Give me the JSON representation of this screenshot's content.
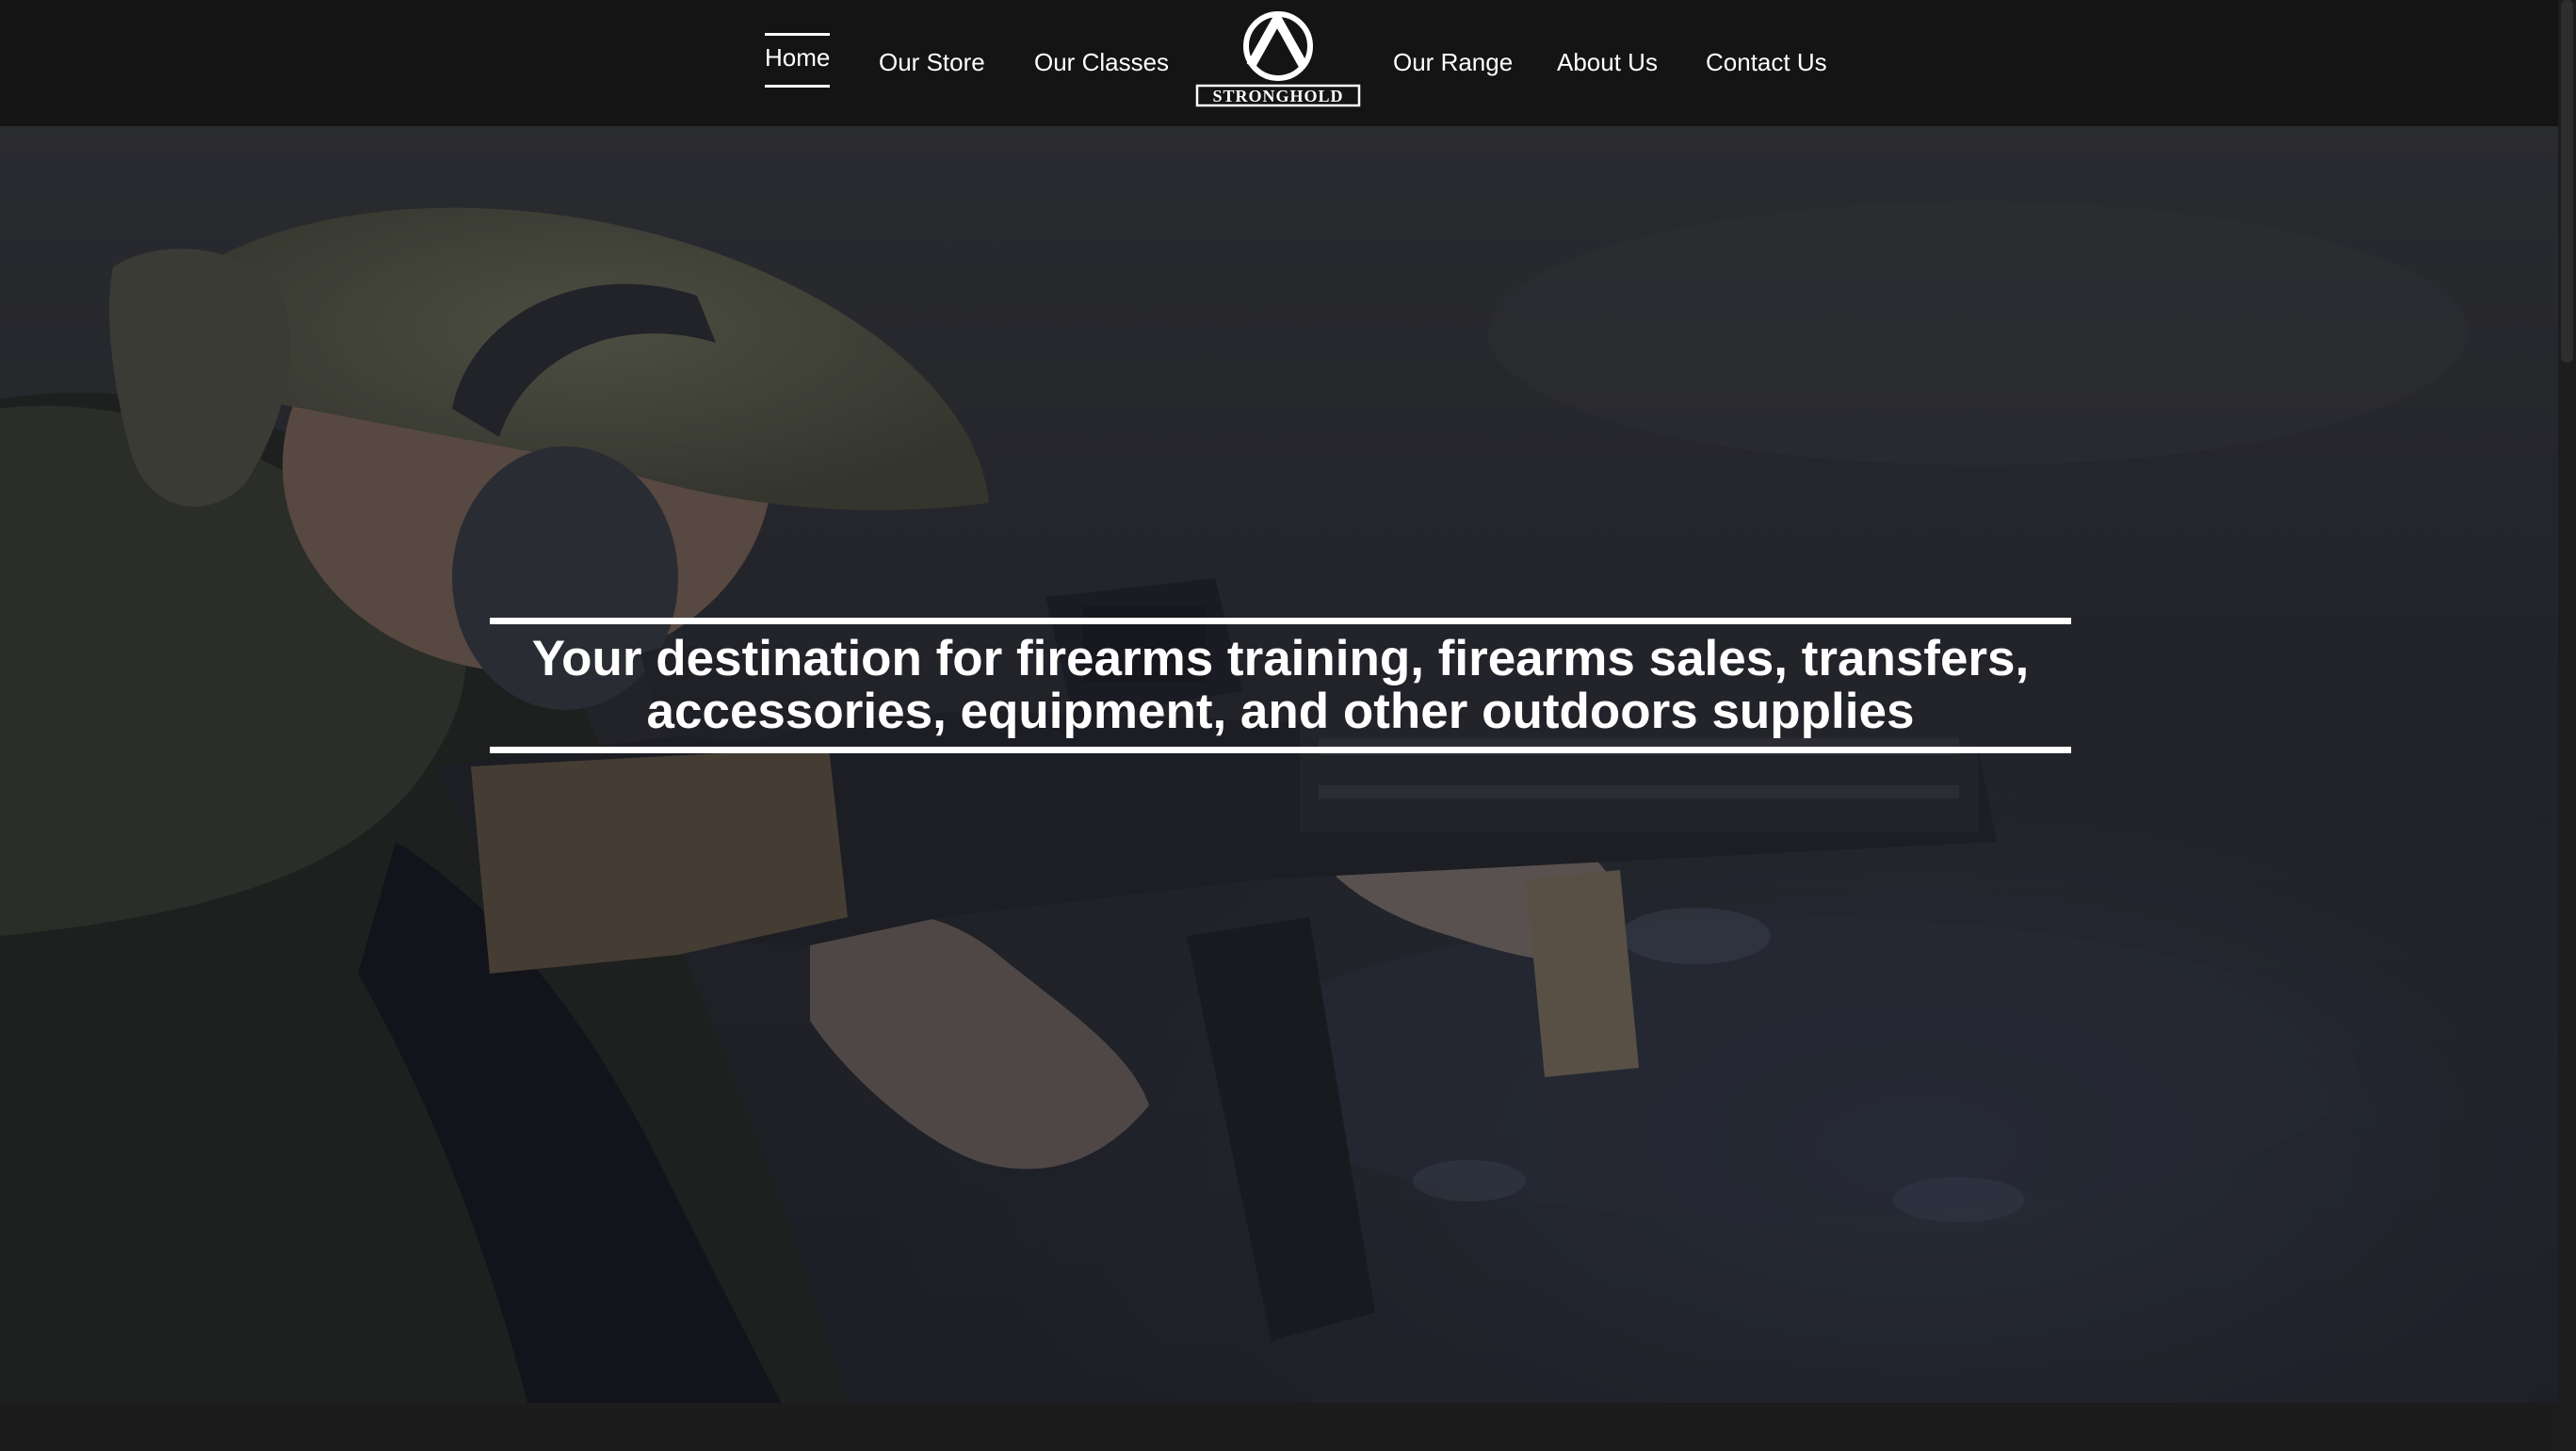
{
  "nav": {
    "left": [
      {
        "label": "Home",
        "active": true
      },
      {
        "label": "Our Store"
      },
      {
        "label": "Our Classes"
      }
    ],
    "right": [
      {
        "label": "Our Range"
      },
      {
        "label": "About Us"
      },
      {
        "label": "Contact Us"
      }
    ],
    "logo": {
      "text": "STRONGHOLD"
    }
  },
  "hero": {
    "headline": "Your destination for firearms training, firearms sales, transfers, accessories, equipment, and other outdoors supplies"
  },
  "colors": {
    "nav_bg": "#141414",
    "text": "#ffffff",
    "page_bg": "#1a1a1a"
  }
}
